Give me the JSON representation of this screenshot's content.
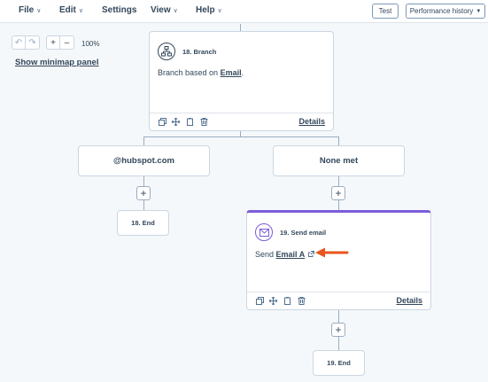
{
  "menu": {
    "file": "File",
    "edit": "Edit",
    "settings": "Settings",
    "view": "View",
    "help": "Help",
    "test_button": "Test",
    "performance_history": "Performance history"
  },
  "canvas_controls": {
    "undo_icon": "undo-icon",
    "redo_icon": "redo-icon",
    "zoom_in_icon": "plus-icon",
    "zoom_out_icon": "minus-icon",
    "zoom_level": "100%",
    "minimap_link": "Show minimap panel"
  },
  "branch_action": {
    "title": "18. Branch",
    "body_prefix": "Branch based on ",
    "body_link": "Email",
    "body_suffix": ".",
    "details": "Details",
    "icon": "branch-icon"
  },
  "branches": {
    "left_label": "@hubspot.com",
    "right_label": "None met"
  },
  "left_end": {
    "label": "18. End"
  },
  "send_email_action": {
    "title": "19. Send email",
    "body_prefix": "Send ",
    "body_link": "Email A",
    "details": "Details",
    "icon": "envelope-icon",
    "accent_color": "#7c5cd9"
  },
  "right_end": {
    "label": "19. End"
  },
  "annotation": {
    "arrow_color": "#e8541e"
  },
  "colors": {
    "text": "#33475b",
    "border": "#cbd6e2",
    "connector": "#99acc2",
    "canvas_bg": "#f5f8fa"
  }
}
